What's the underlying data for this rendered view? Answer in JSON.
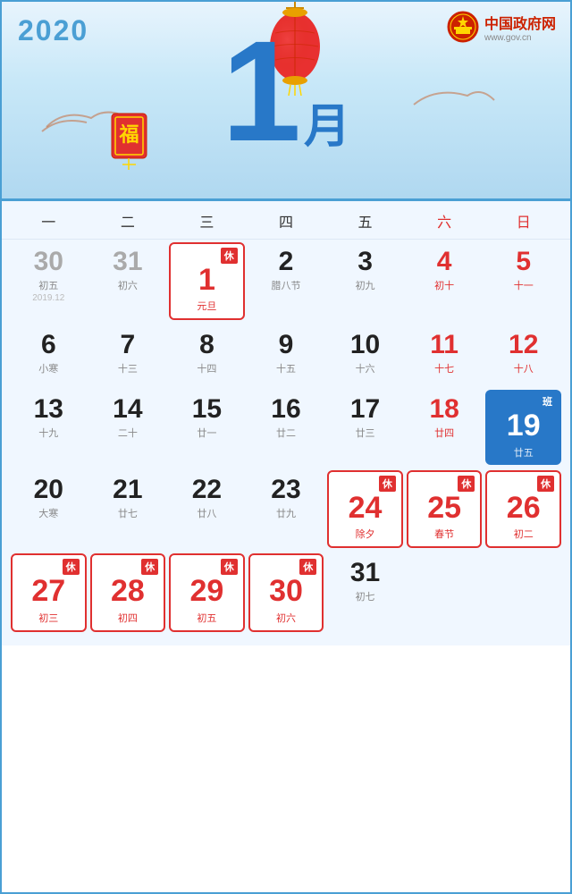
{
  "header": {
    "year": "2020",
    "month_number": "1",
    "month_char": "月",
    "gov_name": "中国政府网",
    "gov_url": "www.gov.cn"
  },
  "weekdays": [
    {
      "label": "一",
      "is_weekend": false
    },
    {
      "label": "二",
      "is_weekend": false
    },
    {
      "label": "三",
      "is_weekend": false
    },
    {
      "label": "四",
      "is_weekend": false
    },
    {
      "label": "五",
      "is_weekend": false
    },
    {
      "label": "六",
      "is_weekend": true
    },
    {
      "label": "日",
      "is_weekend": true
    }
  ],
  "calendar": {
    "prev_month_label": "2019.12",
    "days": [
      {
        "date": "30",
        "lunar": "初五",
        "note": "",
        "type": "prev",
        "holiday": "",
        "work": false
      },
      {
        "date": "31",
        "lunar": "初六",
        "note": "",
        "type": "prev",
        "holiday": "",
        "work": false
      },
      {
        "date": "1",
        "lunar": "元旦",
        "note": "",
        "type": "current",
        "holiday": "休",
        "work": false
      },
      {
        "date": "2",
        "lunar": "腊八节",
        "note": "",
        "type": "current",
        "holiday": "",
        "work": false
      },
      {
        "date": "3",
        "lunar": "初九",
        "note": "",
        "type": "current",
        "holiday": "",
        "work": false
      },
      {
        "date": "4",
        "lunar": "初十",
        "note": "",
        "type": "current",
        "holiday": "",
        "work": false,
        "red": true
      },
      {
        "date": "5",
        "lunar": "十一",
        "note": "",
        "type": "current",
        "holiday": "",
        "work": false,
        "red": true
      },
      {
        "date": "6",
        "lunar": "小寒",
        "note": "",
        "type": "current",
        "holiday": "",
        "work": false
      },
      {
        "date": "7",
        "lunar": "十三",
        "note": "",
        "type": "current",
        "holiday": "",
        "work": false
      },
      {
        "date": "8",
        "lunar": "十四",
        "note": "",
        "type": "current",
        "holiday": "",
        "work": false
      },
      {
        "date": "9",
        "lunar": "十五",
        "note": "",
        "type": "current",
        "holiday": "",
        "work": false
      },
      {
        "date": "10",
        "lunar": "十六",
        "note": "",
        "type": "current",
        "holiday": "",
        "work": false
      },
      {
        "date": "11",
        "lunar": "十七",
        "note": "",
        "type": "current",
        "holiday": "",
        "work": false,
        "red": true
      },
      {
        "date": "12",
        "lunar": "十八",
        "note": "",
        "type": "current",
        "holiday": "",
        "work": false,
        "red": true
      },
      {
        "date": "13",
        "lunar": "十九",
        "note": "",
        "type": "current",
        "holiday": "",
        "work": false
      },
      {
        "date": "14",
        "lunar": "二十",
        "note": "",
        "type": "current",
        "holiday": "",
        "work": false
      },
      {
        "date": "15",
        "lunar": "廿一",
        "note": "",
        "type": "current",
        "holiday": "",
        "work": false
      },
      {
        "date": "16",
        "lunar": "廿二",
        "note": "",
        "type": "current",
        "holiday": "",
        "work": false
      },
      {
        "date": "17",
        "lunar": "廿三",
        "note": "",
        "type": "current",
        "holiday": "",
        "work": false
      },
      {
        "date": "18",
        "lunar": "廿四",
        "note": "",
        "type": "current",
        "holiday": "",
        "work": false,
        "red": true
      },
      {
        "date": "19",
        "lunar": "廿五",
        "note": "",
        "type": "current",
        "holiday": "",
        "work": true
      },
      {
        "date": "20",
        "lunar": "大寒",
        "note": "",
        "type": "current",
        "holiday": "",
        "work": false
      },
      {
        "date": "21",
        "lunar": "廿七",
        "note": "",
        "type": "current",
        "holiday": "",
        "work": false
      },
      {
        "date": "22",
        "lunar": "廿八",
        "note": "",
        "type": "current",
        "holiday": "",
        "work": false
      },
      {
        "date": "23",
        "lunar": "廿九",
        "note": "",
        "type": "current",
        "holiday": "",
        "work": false
      },
      {
        "date": "24",
        "lunar": "除夕",
        "note": "",
        "type": "current",
        "holiday": "休",
        "work": false
      },
      {
        "date": "25",
        "lunar": "春节",
        "note": "",
        "type": "current",
        "holiday": "休",
        "work": false
      },
      {
        "date": "26",
        "lunar": "初二",
        "note": "",
        "type": "current",
        "holiday": "休",
        "work": false
      },
      {
        "date": "27",
        "lunar": "初三",
        "note": "",
        "type": "current",
        "holiday": "休",
        "work": false
      },
      {
        "date": "28",
        "lunar": "初四",
        "note": "",
        "type": "current",
        "holiday": "休",
        "work": false
      },
      {
        "date": "29",
        "lunar": "初五",
        "note": "",
        "type": "current",
        "holiday": "休",
        "work": false
      },
      {
        "date": "30",
        "lunar": "初六",
        "note": "",
        "type": "current",
        "holiday": "休",
        "work": false
      },
      {
        "date": "31",
        "lunar": "初七",
        "note": "",
        "type": "current",
        "holiday": "",
        "work": false
      },
      {
        "date": "",
        "lunar": "",
        "note": "",
        "type": "empty",
        "holiday": "",
        "work": false
      },
      {
        "date": "",
        "lunar": "",
        "note": "",
        "type": "empty",
        "holiday": "",
        "work": false
      }
    ]
  }
}
